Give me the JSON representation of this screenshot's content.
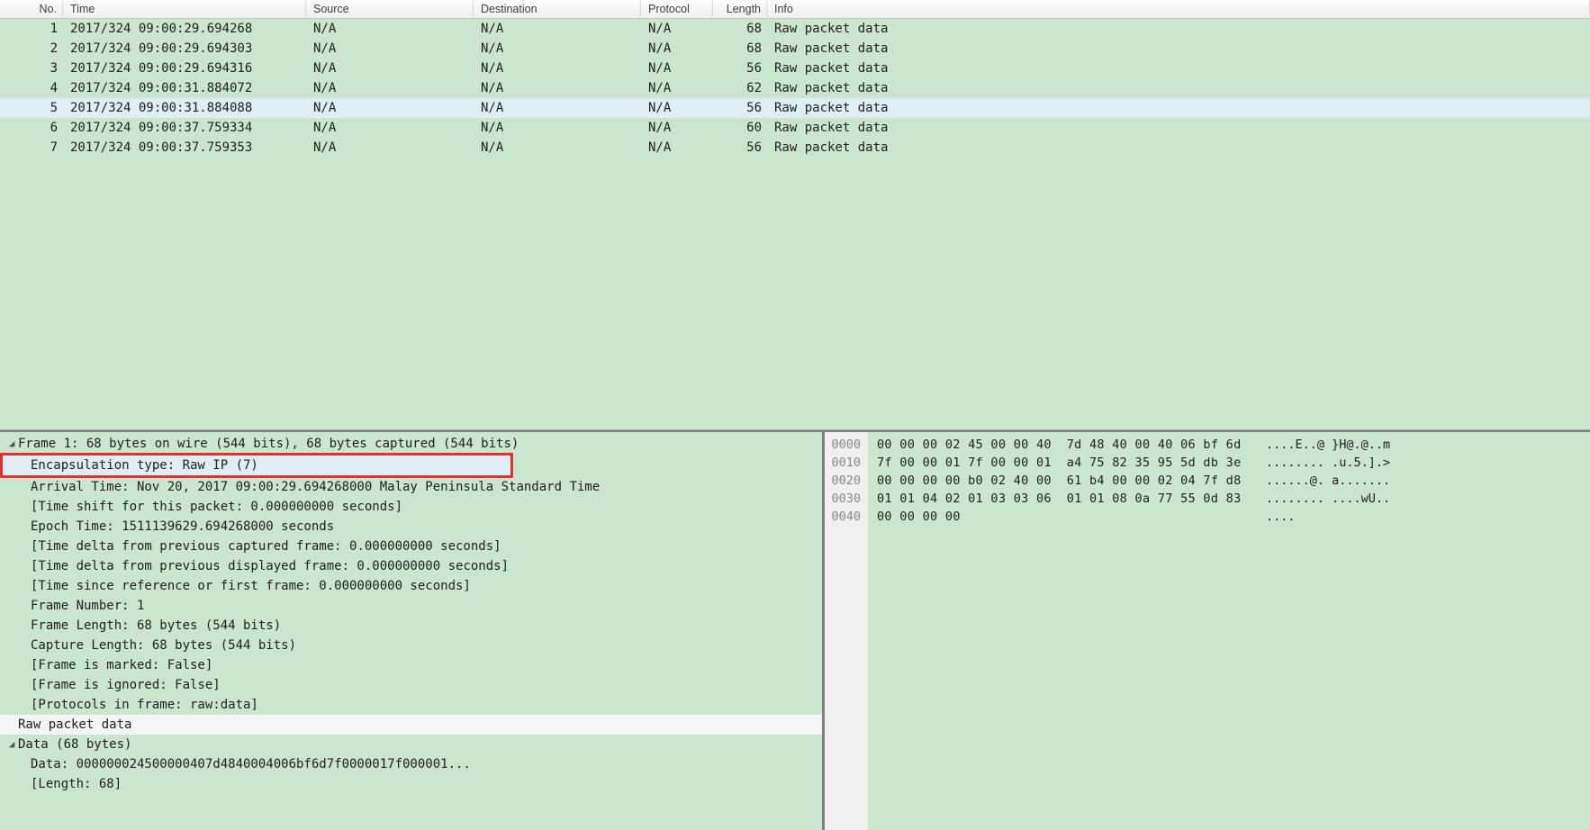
{
  "columns": {
    "no": "No.",
    "time": "Time",
    "src": "Source",
    "dst": "Destination",
    "proto": "Protocol",
    "len": "Length",
    "info": "Info"
  },
  "packets": [
    {
      "no": "1",
      "time": "2017/324 09:00:29.694268",
      "src": "N/A",
      "dst": "N/A",
      "proto": "N/A",
      "len": "68",
      "info": "Raw packet data",
      "sel": false
    },
    {
      "no": "2",
      "time": "2017/324 09:00:29.694303",
      "src": "N/A",
      "dst": "N/A",
      "proto": "N/A",
      "len": "68",
      "info": "Raw packet data",
      "sel": false
    },
    {
      "no": "3",
      "time": "2017/324 09:00:29.694316",
      "src": "N/A",
      "dst": "N/A",
      "proto": "N/A",
      "len": "56",
      "info": "Raw packet data",
      "sel": false
    },
    {
      "no": "4",
      "time": "2017/324 09:00:31.884072",
      "src": "N/A",
      "dst": "N/A",
      "proto": "N/A",
      "len": "62",
      "info": "Raw packet data",
      "sel": false
    },
    {
      "no": "5",
      "time": "2017/324 09:00:31.884088",
      "src": "N/A",
      "dst": "N/A",
      "proto": "N/A",
      "len": "56",
      "info": "Raw packet data",
      "sel": true
    },
    {
      "no": "6",
      "time": "2017/324 09:00:37.759334",
      "src": "N/A",
      "dst": "N/A",
      "proto": "N/A",
      "len": "60",
      "info": "Raw packet data",
      "sel": false
    },
    {
      "no": "7",
      "time": "2017/324 09:00:37.759353",
      "src": "N/A",
      "dst": "N/A",
      "proto": "N/A",
      "len": "56",
      "info": "Raw packet data",
      "sel": false
    }
  ],
  "details": {
    "frame_header": "Frame 1: 68 bytes on wire (544 bits), 68 bytes captured (544 bits)",
    "encap": "Encapsulation type: Raw IP (7)",
    "arrival": "Arrival Time: Nov 20, 2017 09:00:29.694268000 Malay Peninsula Standard Time",
    "time_shift": "[Time shift for this packet: 0.000000000 seconds]",
    "epoch": "Epoch Time: 1511139629.694268000 seconds",
    "delta_cap": "[Time delta from previous captured frame: 0.000000000 seconds]",
    "delta_disp": "[Time delta from previous displayed frame: 0.000000000 seconds]",
    "since_ref": "[Time since reference or first frame: 0.000000000 seconds]",
    "frame_no": "Frame Number: 1",
    "frame_len": "Frame Length: 68 bytes (544 bits)",
    "cap_len": "Capture Length: 68 bytes (544 bits)",
    "marked": "[Frame is marked: False]",
    "ignored": "[Frame is ignored: False]",
    "protos": "[Protocols in frame: raw:data]",
    "raw": "Raw packet data",
    "data_hdr": "Data (68 bytes)",
    "data_val": "Data: 000000024500000407d4840004006bf6d7f0000017f000001...",
    "length": "[Length: 68]"
  },
  "hex": {
    "offsets": [
      "0000",
      "0010",
      "0020",
      "0030",
      "0040"
    ],
    "lines": [
      {
        "bytes": "00 00 00 02 45 00 00 40  7d 48 40 00 40 06 bf 6d",
        "ascii": "....E..@ }H@.@..m"
      },
      {
        "bytes": "7f 00 00 01 7f 00 00 01  a4 75 82 35 95 5d db 3e",
        "ascii": "........ .u.5.].>"
      },
      {
        "bytes": "00 00 00 00 b0 02 40 00  61 b4 00 00 02 04 7f d8",
        "ascii": "......@. a......."
      },
      {
        "bytes": "01 01 04 02 01 03 03 06  01 01 08 0a 77 55 0d 83",
        "ascii": "........ ....wU.."
      },
      {
        "bytes": "00 00 00 00",
        "ascii": "...."
      }
    ]
  },
  "tri_open": "◢",
  "tri_closed": "▷"
}
